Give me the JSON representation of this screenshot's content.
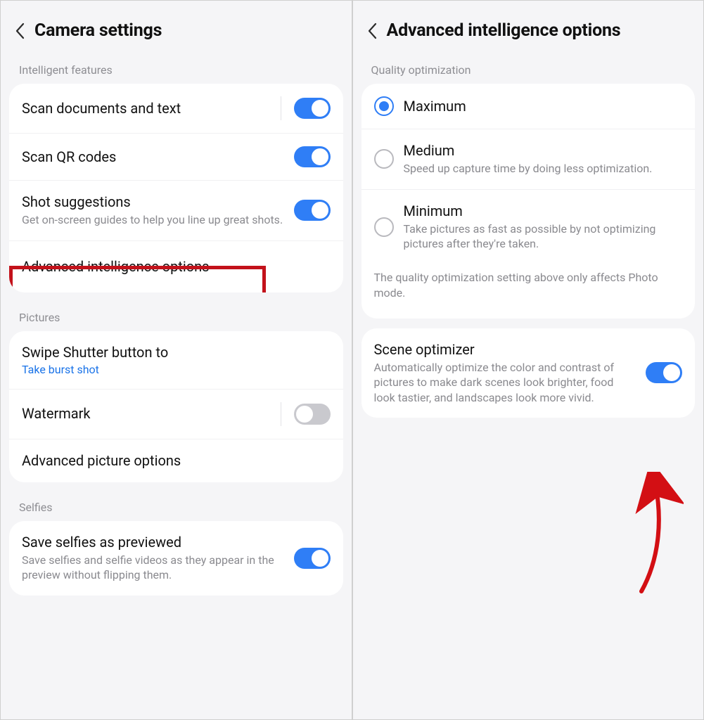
{
  "left": {
    "title": "Camera settings",
    "sections": {
      "intelligent": {
        "header": "Intelligent features",
        "scan_docs": {
          "title": "Scan documents and text",
          "on": true
        },
        "scan_qr": {
          "title": "Scan QR codes",
          "on": true
        },
        "shot_suggestions": {
          "title": "Shot suggestions",
          "sub": "Get on-screen guides to help you line up great shots.",
          "on": true
        },
        "advanced": {
          "title": "Advanced intelligence options"
        }
      },
      "pictures": {
        "header": "Pictures",
        "swipe": {
          "title": "Swipe Shutter button to",
          "value": "Take burst shot"
        },
        "watermark": {
          "title": "Watermark",
          "on": false
        },
        "advanced_pic": {
          "title": "Advanced picture options"
        }
      },
      "selfies": {
        "header": "Selfies",
        "save_previewed": {
          "title": "Save selfies as previewed",
          "sub": "Save selfies and selfie videos as they appear in the preview without flipping them.",
          "on": true
        }
      }
    }
  },
  "right": {
    "title": "Advanced intelligence options",
    "quality": {
      "header": "Quality optimization",
      "maximum": {
        "title": "Maximum",
        "selected": true
      },
      "medium": {
        "title": "Medium",
        "sub": "Speed up capture time by doing less optimization.",
        "selected": false
      },
      "minimum": {
        "title": "Minimum",
        "sub": "Take pictures as fast as possible by not optimizing pictures after they're taken.",
        "selected": false
      },
      "note": "The quality optimization setting above only affects Photo mode."
    },
    "scene_optimizer": {
      "title": "Scene optimizer",
      "sub": "Automatically optimize the color and contrast of pictures to make dark scenes look brighter, food look tastier, and landscapes look more vivid.",
      "on": true
    }
  }
}
